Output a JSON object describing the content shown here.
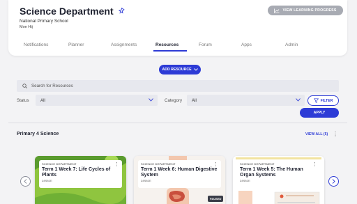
{
  "header": {
    "title": "Science Department",
    "school": "National Primary School",
    "user": "Moe Htj",
    "progress_label": "VIEW LEARNING PROGRESS"
  },
  "tabs": [
    {
      "label": "Notifications"
    },
    {
      "label": "Planner"
    },
    {
      "label": "Assignments"
    },
    {
      "label": "Resources",
      "active": true
    },
    {
      "label": "Forum"
    },
    {
      "label": "Apps"
    },
    {
      "label": "Admin"
    }
  ],
  "toolbar": {
    "add_label": "ADD RESOURCE"
  },
  "search": {
    "placeholder": "Search for Resources"
  },
  "filters": {
    "status_label": "Status",
    "status_value": "All",
    "category_label": "Category",
    "category_value": "All",
    "filter_label": "FILTER",
    "apply_label": "APPLY"
  },
  "section": {
    "title": "Primary 4 Science",
    "view_all": "VIEW ALL (5)"
  },
  "cards": [
    {
      "dept": "SCIENCE DEPARTMENT",
      "title": "Term 1 Week 7: Life Cycles of Plants",
      "type": "Lesson"
    },
    {
      "dept": "SCIENCE DEPARTMENT",
      "title": "Term 1 Week 6: Human Digestive System",
      "type": "Lesson",
      "badge": "PAUSED"
    },
    {
      "dept": "SCIENCE DEPARTMENT",
      "title": "Term 1 Week 5: The Human Organ Systems",
      "type": "Lesson"
    }
  ],
  "colors": {
    "accent": "#2d3bd6",
    "progress_button": "#a8abb3",
    "background": "#f3f3f5"
  }
}
